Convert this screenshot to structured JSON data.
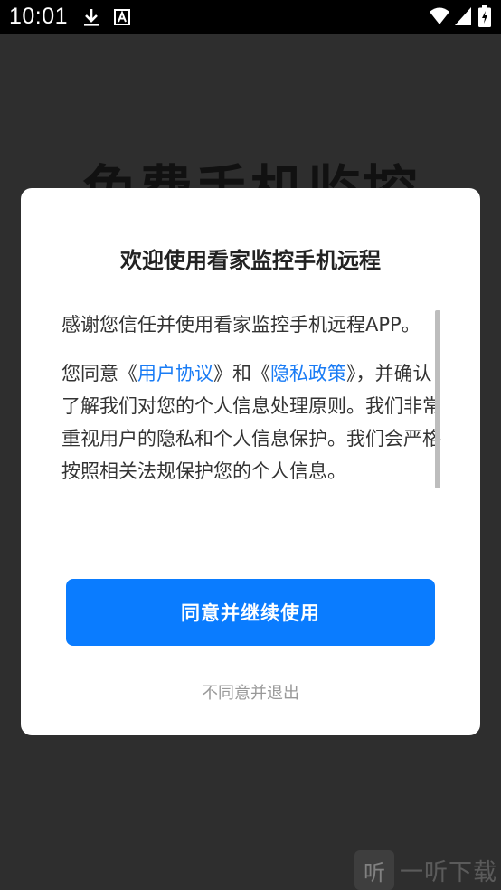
{
  "status_bar": {
    "time": "10:01",
    "icons": [
      "download-icon",
      "font-a-icon",
      "wifi-icon",
      "signal-icon",
      "battery-icon"
    ]
  },
  "background": {
    "title": "免费手机监控"
  },
  "dialog": {
    "title": "欢迎使用看家监控手机远程",
    "paragraph1": "感谢您信任并使用看家监控手机远程APP。",
    "p2_prefix": "您同意《",
    "user_agreement_link": "用户协议",
    "p2_mid": "》和《",
    "privacy_policy_link": "隐私政策",
    "p2_suffix": "》，并确认了解我们对您的个人信息处理原则。我们非常重视用户的隐私和个人信息保护。我们会严格按照相关法规保护您的个人信息。",
    "agree_button": "同意并继续使用",
    "disagree_button": "不同意并退出"
  },
  "watermark": {
    "logo_text": "听",
    "text": "一听下载"
  },
  "colors": {
    "accent": "#0a7cff",
    "link": "#1a7cf5",
    "overlay": "#2e2e2e"
  }
}
